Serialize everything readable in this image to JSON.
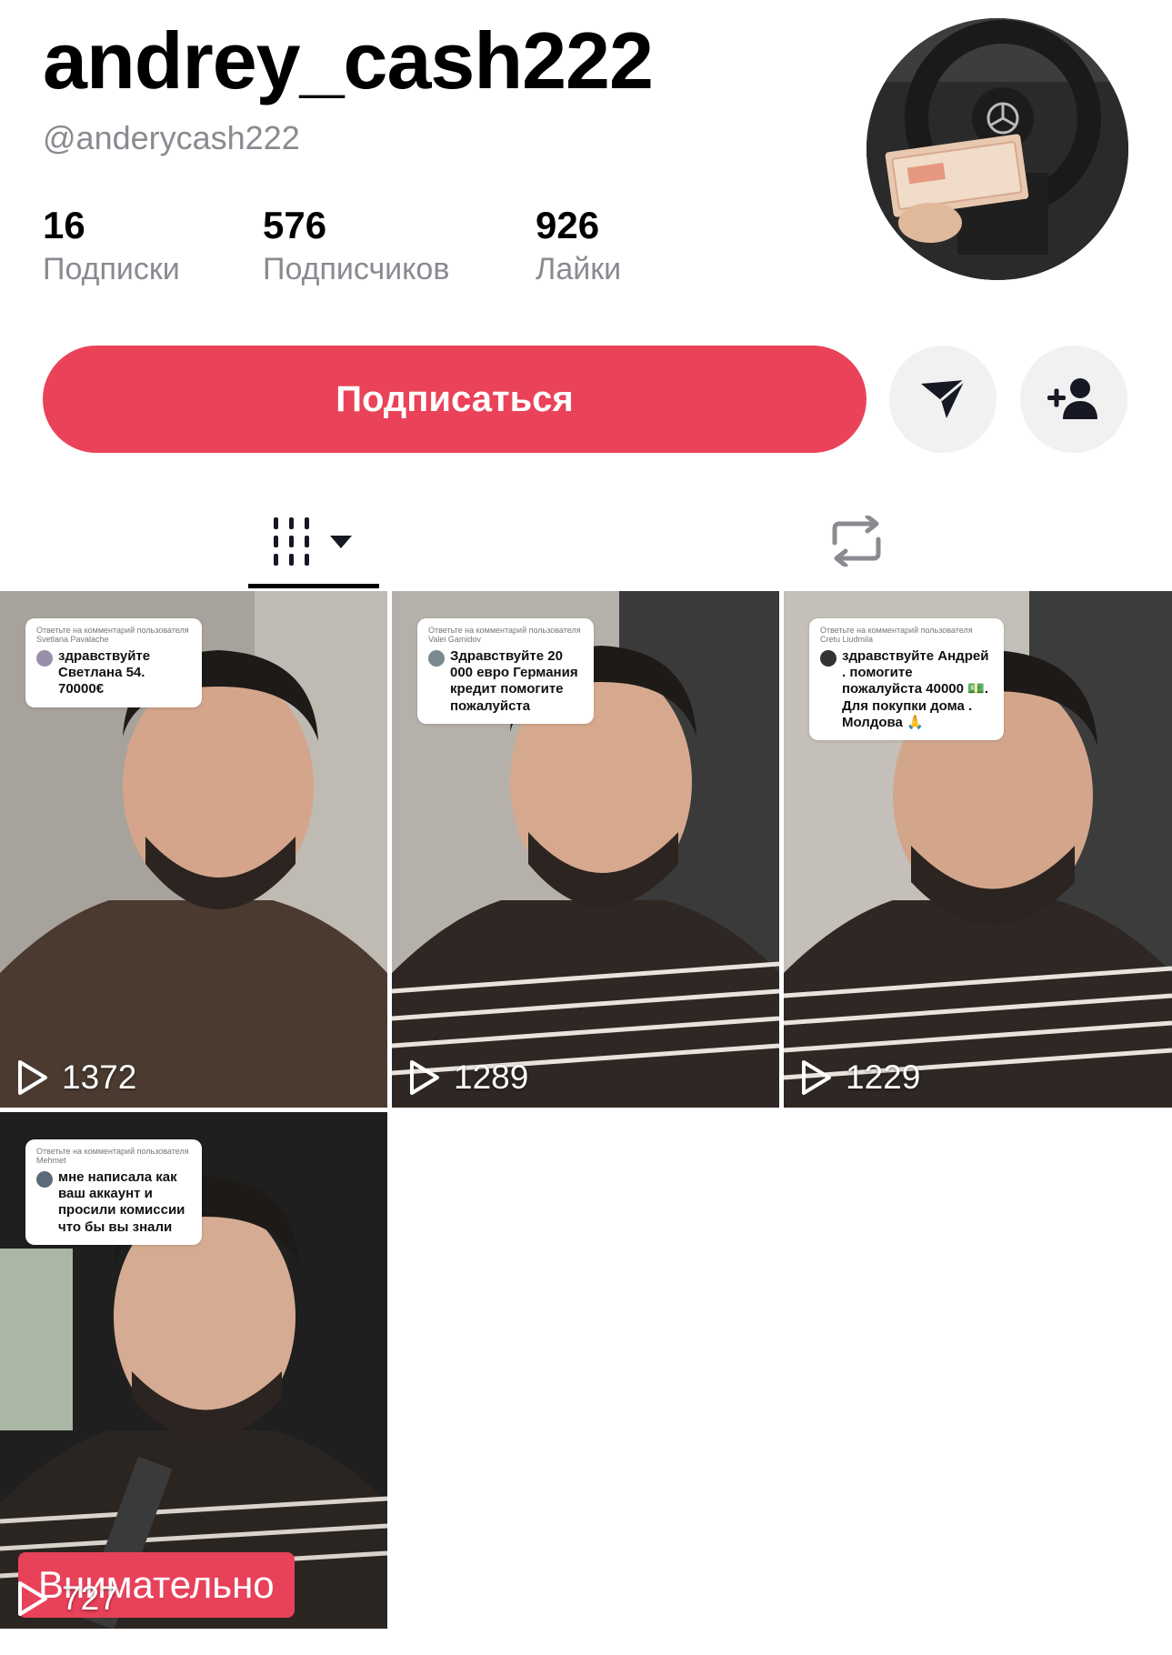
{
  "profile": {
    "username": "andrey_cash222",
    "handle": "@anderycash222"
  },
  "stats": [
    {
      "value": "16",
      "label": "Подписки"
    },
    {
      "value": "576",
      "label": "Подписчиков"
    },
    {
      "value": "926",
      "label": "Лайки"
    }
  ],
  "actions": {
    "follow_label": "Подписаться",
    "accent_color": "#ea4359"
  },
  "tabs": {
    "videos_icon": "grid-icon",
    "reposts_icon": "repost-icon"
  },
  "videos": [
    {
      "reply_to": "Ответьте на комментарий пользователя Svetlana Pavalache",
      "comment": "здравствуйте Светлана 54. 70000€",
      "views": "1372"
    },
    {
      "reply_to": "Ответьте на комментарий пользователя Valei Gamidov",
      "comment": "Здравствуйте 20 000 евро Германия кредит помогите пожалуйста",
      "views": "1289"
    },
    {
      "reply_to": "Ответьте на комментарий пользователя Cretu Liudmila",
      "comment": "здравствуйте Андрей . помогите пожалуйста 40000 💵. Для покупки дома . Молдова 🙏",
      "views": "1229"
    },
    {
      "reply_to": "Ответьте на комментарий пользователя Mehmet",
      "comment": "мне написала как ваш аккаунт и просили комиссии что бы вы знали",
      "views": "727",
      "caption": "Внимательно"
    }
  ]
}
